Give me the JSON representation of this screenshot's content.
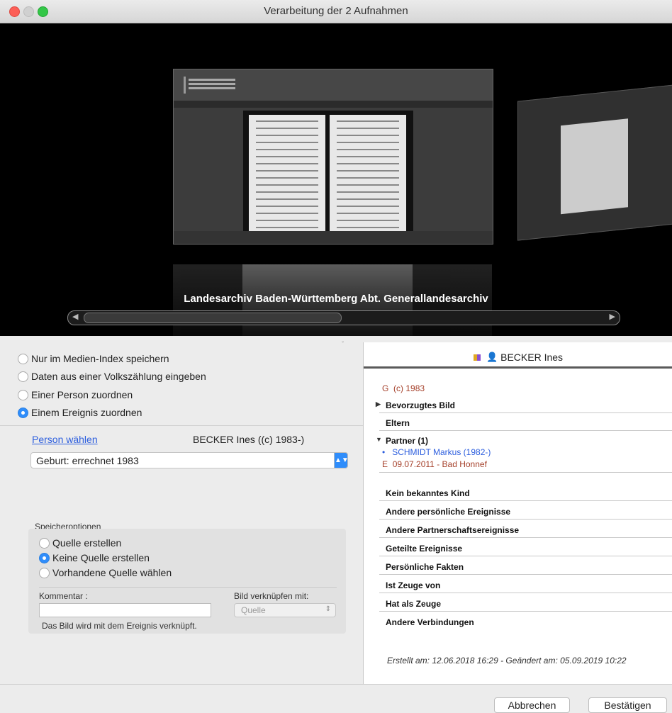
{
  "window": {
    "title": "Verarbeitung der 2 Aufnahmen"
  },
  "preview": {
    "caption": "Landesarchiv Baden-Württemberg Abt. Generallandesarchiv"
  },
  "options": {
    "items": [
      {
        "label": "Nur im Medien-Index speichern",
        "selected": false
      },
      {
        "label": "Daten aus einer Volkszählung eingeben",
        "selected": false
      },
      {
        "label": "Einer Person zuordnen",
        "selected": false
      },
      {
        "label": "Einem Ereignis zuordnen",
        "selected": true
      }
    ]
  },
  "assign": {
    "person_link": "Person wählen",
    "person_name": "BECKER Ines ((c) 1983-)",
    "event_value": "Geburt:  errechnet 1983"
  },
  "save": {
    "label": "Speicheroptionen",
    "options": [
      {
        "label": "Quelle erstellen",
        "selected": false
      },
      {
        "label": "Keine Quelle erstellen",
        "selected": true
      },
      {
        "label": "Vorhandene Quelle wählen",
        "selected": false
      }
    ],
    "comment_label": "Kommentar :",
    "link_label": "Bild verknüpfen mit:",
    "source_select": "Quelle",
    "hint": "Das Bild wird mit dem Ereignis verknüpft."
  },
  "person_panel": {
    "name": "BECKER Ines",
    "g_prefix": "G",
    "g_value": "(c) 1983",
    "rows": {
      "preferred_image": "Bevorzugtes Bild",
      "parents": "Eltern",
      "partner": "Partner (1)",
      "no_child": "Kein bekanntes Kind",
      "other_personal_events": "Andere persönliche Ereignisse",
      "other_partner_events": "Andere Partnerschaftsereignisse",
      "shared_events": "Geteilte Ereignisse",
      "personal_facts": "Persönliche Fakten",
      "is_witness_of": "Ist Zeuge von",
      "has_witness": "Hat als Zeuge",
      "other_connections": "Andere Verbindungen"
    },
    "partner_name": "SCHMIDT Markus (1982-)",
    "partner_bullet": "•",
    "marriage_prefix": "E",
    "marriage": "09.07.2011 - Bad Honnef",
    "meta": "Erstellt am: 12.06.2018 16:29 - Geändert am: 05.09.2019 10:22"
  },
  "buttons": {
    "cancel": "Abbrechen",
    "confirm": "Bestätigen"
  },
  "colors": {
    "accent": "#2f8dfb",
    "link": "#2c5ede",
    "event_red": "#a5402a",
    "partner_blue": "#2c5ede"
  }
}
